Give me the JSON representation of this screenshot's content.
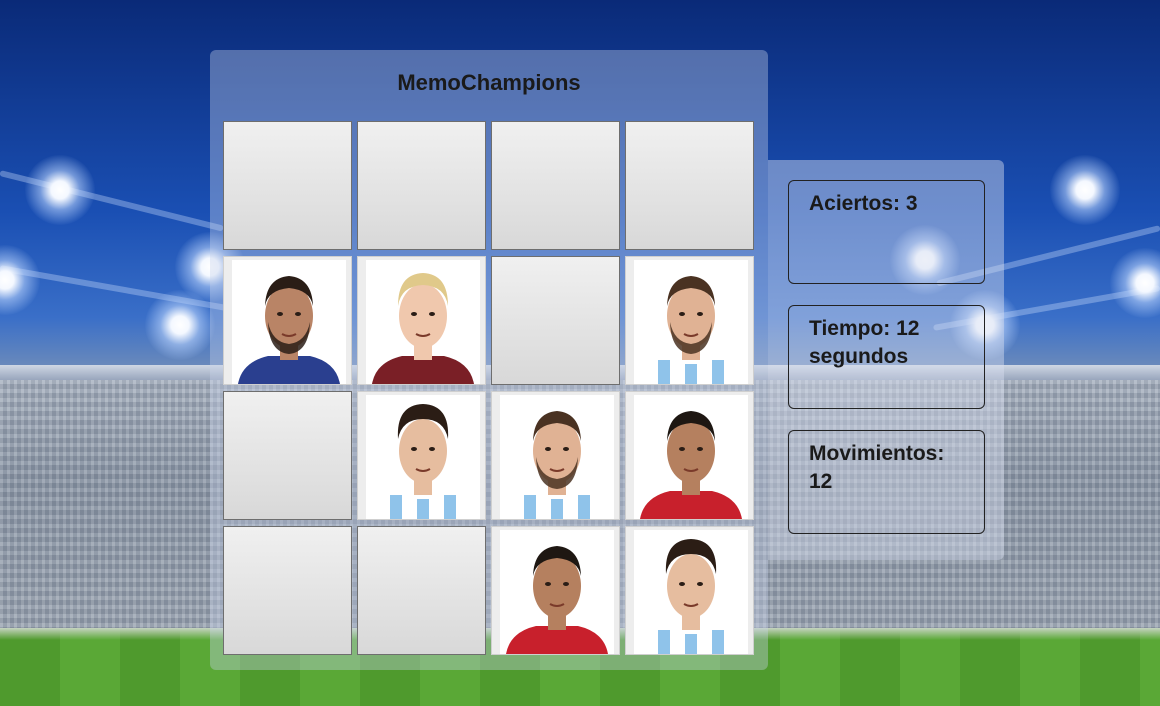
{
  "game": {
    "title": "MemoChampions"
  },
  "board": {
    "cards": [
      {
        "state": "hidden",
        "player": ""
      },
      {
        "state": "hidden",
        "player": ""
      },
      {
        "state": "hidden",
        "player": ""
      },
      {
        "state": "hidden",
        "player": ""
      },
      {
        "state": "revealed",
        "player": "benzema"
      },
      {
        "state": "revealed",
        "player": "haaland"
      },
      {
        "state": "hidden",
        "player": ""
      },
      {
        "state": "revealed",
        "player": "messi"
      },
      {
        "state": "hidden",
        "player": ""
      },
      {
        "state": "revealed",
        "player": "julian-alvarez"
      },
      {
        "state": "revealed",
        "player": "messi"
      },
      {
        "state": "revealed",
        "player": "ronaldo"
      },
      {
        "state": "hidden",
        "player": ""
      },
      {
        "state": "hidden",
        "player": ""
      },
      {
        "state": "revealed",
        "player": "ronaldo"
      },
      {
        "state": "revealed",
        "player": "julian-alvarez"
      }
    ]
  },
  "stats": {
    "aciertos_text": "Aciertos: 3",
    "tiempo_line1": "Tiempo: 12",
    "tiempo_line2": "segundos",
    "movimientos_line1": "Movimientos:",
    "movimientos_line2": "12"
  },
  "colors": {
    "board_bg": "#c8d2eb",
    "card_back": "#e6e6e6",
    "text": "#1a1a1a"
  }
}
